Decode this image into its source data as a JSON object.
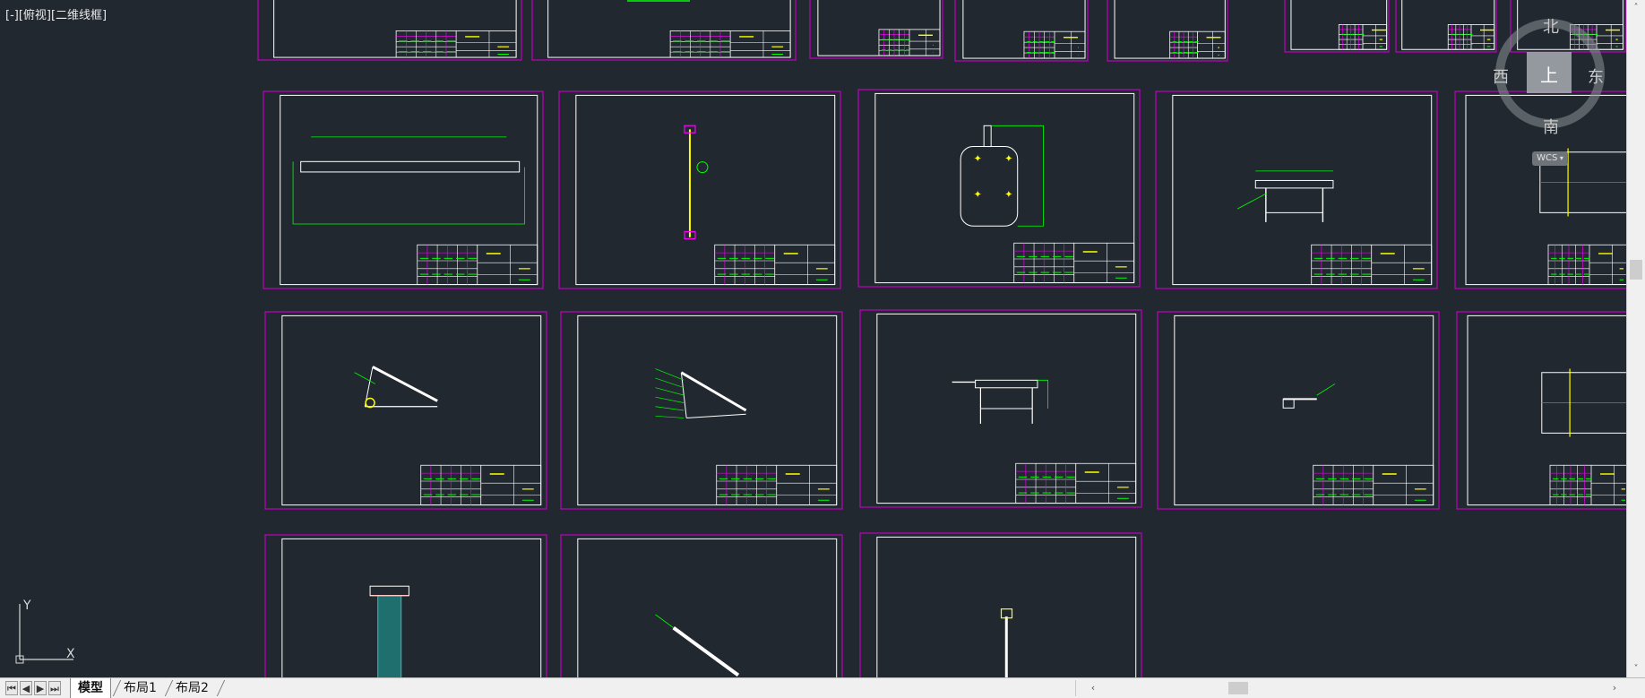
{
  "viewport": {
    "label": "[-][俯视][二维线框]",
    "background": "#212830",
    "sheet_border_color": "#c000c0",
    "inner_border_color": "#ffffff",
    "drawing_color": "#00ff00",
    "highlight_color": "#ff00ff",
    "accent_yellow": "#ffff00"
  },
  "viewcube": {
    "north": "北",
    "south": "南",
    "west": "西",
    "east": "东",
    "top": "上",
    "wcs": "WCS"
  },
  "ucs_icon": {
    "x_label": "X",
    "y_label": "Y"
  },
  "tabs": {
    "model": "模型",
    "layout1": "布局1",
    "layout2": "布局2"
  },
  "nav_icons": [
    "first-icon",
    "prev-icon",
    "next-icon",
    "last-icon"
  ],
  "nav_glyphs": [
    "⏮",
    "◀",
    "▶",
    "⏭"
  ],
  "scroll_arrows": {
    "left": "‹",
    "right": "›",
    "up": "˄",
    "down": "˅"
  }
}
